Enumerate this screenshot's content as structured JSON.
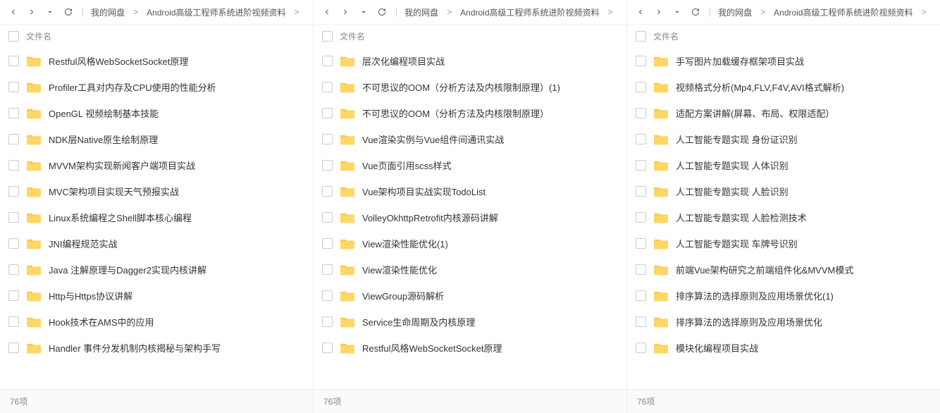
{
  "breadcrumb": {
    "root": "我的网盘",
    "current": "Android高级工程师系统进阶视频资料"
  },
  "header": {
    "filename_col": "文件名"
  },
  "status": {
    "count_label": "76项"
  },
  "panels": [
    {
      "items": [
        "Restful风格WebSocketSocket原理",
        "Profiler工具对内存及CPU使用的性能分析",
        "OpenGL 视频绘制基本技能",
        "NDK层Native原生绘制原理",
        "MVVM架构实现新闻客户端项目实战",
        "MVC架构项目实现天气预报实战",
        "Linux系统编程之Shell脚本核心编程",
        "JNI编程规范实战",
        "Java 注解原理与Dagger2实现内核讲解",
        "Http与Https协议讲解",
        "Hook技术在AMS中的应用",
        "Handler 事件分发机制内核揭秘与架构手写"
      ]
    },
    {
      "items": [
        "层次化编程项目实战",
        "不可思议的OOM（分析方法及内核限制原理）(1)",
        "不可思议的OOM（分析方法及内核限制原理）",
        "Vue渲染实例与Vue组件间通讯实战",
        "Vue页面引用scss样式",
        "Vue架构项目实战实现TodoList",
        "VolleyOkhttpRetrofit内核源码讲解",
        "View渲染性能优化(1)",
        "View渲染性能优化",
        "ViewGroup源码解析",
        "Service生命周期及内核原理",
        "Restful风格WebSocketSocket原理"
      ]
    },
    {
      "items": [
        "手写图片加载缓存框架项目实战",
        "视频格式分析(Mp4,FLV,F4V,AVI格式解析)",
        "适配方案讲解(屏幕、布局、权限适配）",
        "人工智能专题实现 身份证识别",
        "人工智能专题实现 人体识别",
        "人工智能专题实现 人脸识别",
        "人工智能专题实现 人脸检测技术",
        "人工智能专题实现 车牌号识别",
        "前端Vue架构研究之前端组件化&MVVM模式",
        "排序算法的选择原则及应用场景优化(1)",
        "排序算法的选择原则及应用场景优化",
        "模块化编程项目实战"
      ]
    }
  ]
}
